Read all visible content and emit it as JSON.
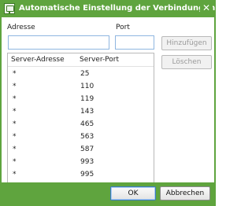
{
  "window": {
    "title": "Automatische Einstellung der Verbindungen",
    "close_glyph": "✕",
    "help_glyph": "?"
  },
  "form": {
    "address_label": "Adresse",
    "address_value": "",
    "port_label": "Port",
    "port_value": ""
  },
  "buttons": {
    "add": "Hinzufügen",
    "delete": "Löschen",
    "ok": "OK",
    "cancel": "Abbrechen"
  },
  "table": {
    "columns": [
      "Server-Adresse",
      "Server-Port"
    ],
    "rows": [
      {
        "address": "*",
        "port": "25"
      },
      {
        "address": "*",
        "port": "110"
      },
      {
        "address": "*",
        "port": "119"
      },
      {
        "address": "*",
        "port": "143"
      },
      {
        "address": "*",
        "port": "465"
      },
      {
        "address": "*",
        "port": "563"
      },
      {
        "address": "*",
        "port": "587"
      },
      {
        "address": "*",
        "port": "993"
      },
      {
        "address": "*",
        "port": "995"
      }
    ]
  },
  "colors": {
    "accent": "#5fa43e",
    "input_border": "#8fb6e0",
    "help_icon": "#2c6fb4"
  }
}
